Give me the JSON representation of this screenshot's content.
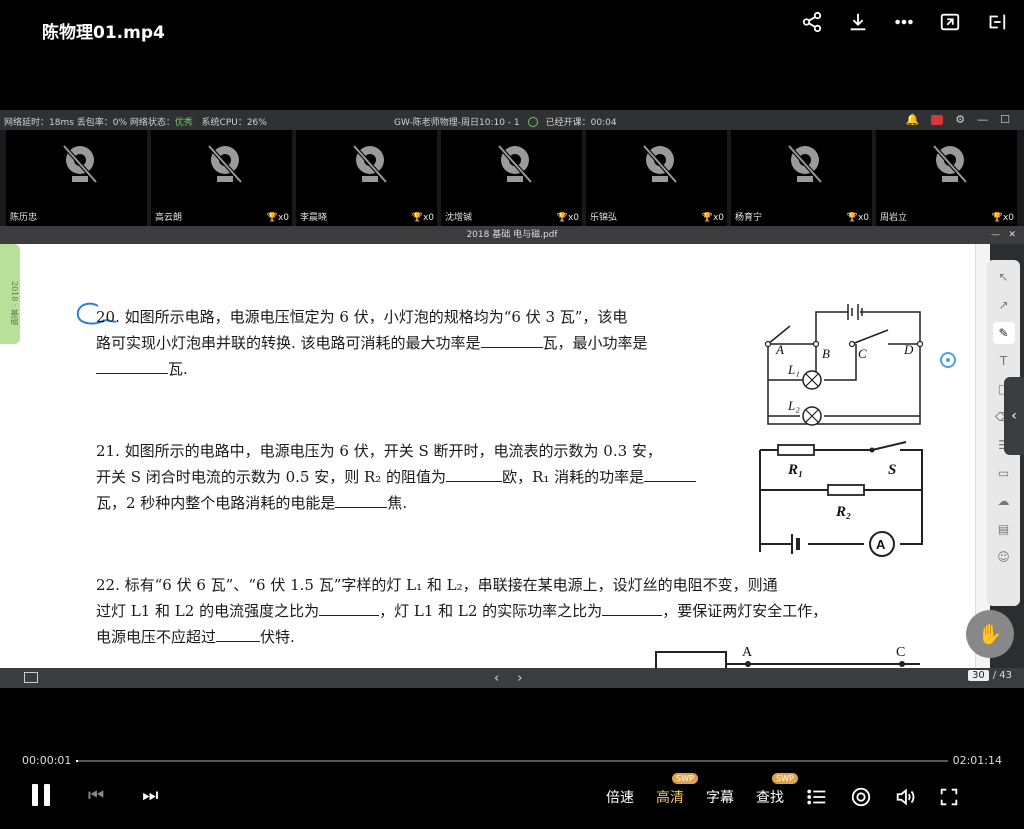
{
  "video": {
    "title": "陈物理01.mp4",
    "time_current": "00:00:01",
    "time_total": "02:01:14",
    "progress_fraction": 0.0001,
    "controls": {
      "speed": "倍速",
      "quality": "高清",
      "quality_badge": "SWP",
      "subtitle": "字幕",
      "search": "查找",
      "search_badge": "SWP"
    }
  },
  "status": {
    "left_text": "网络延时：18ms 丢包率：0% 网络状态：",
    "network_state": "优秀",
    "cpu": "系统CPU：26%",
    "class_title": "GW-陈老师物理-周日10:10 - 1",
    "elapsed": "已经开课：00:04"
  },
  "cameras": [
    {
      "name": "陈历忠",
      "score": ""
    },
    {
      "name": "高云朗",
      "score": "x0"
    },
    {
      "name": "李晨晓",
      "score": "x0"
    },
    {
      "name": "沈增铖",
      "score": "x0"
    },
    {
      "name": "乐锦弘",
      "score": "x0"
    },
    {
      "name": "杨育宁",
      "score": "x0"
    },
    {
      "name": "周岩立",
      "score": "x0"
    }
  ],
  "pdf": {
    "filename": "2018 基础 电与磁.pdf",
    "sidetab": "2018 · 基础",
    "current_page": "30",
    "total_pages": "/ 43"
  },
  "questions": {
    "q20_line1": "20. 如图所示电路，电源电压恒定为 6 伏，小灯泡的规格均为“6 伏   3 瓦”，该电",
    "q20_line2a": "路可实现小灯泡串并联的转换. 该电路可消耗的最大功率是",
    "q20_line2b": "瓦，最小功率是",
    "q20_line3": "瓦.",
    "q21_line1": "21. 如图所示的电路中，电源电压为 6 伏，开关 S 断开时，电流表的示数为 0.3 安，",
    "q21_line2a": "开关 S 闭合时电流的示数为 0.5 安，则 R₂ 的阻值为",
    "q21_line2b": "欧，R₁ 消耗的功率是",
    "q21_line3a": "瓦，2 秒种内整个电路消耗的电能是",
    "q21_line3b": "焦.",
    "q22_line1": "22. 标有“6 伏   6 瓦”、“6 伏   1.5 瓦”字样的灯 L₁ 和 L₂，串联接在某电源上，设灯丝的电阻不变，则通",
    "q22_line2a": "过灯 L1 和 L2 的电流强度之比为",
    "q22_line2b": "，灯 L1 和 L2 的实际功率之比为",
    "q22_line2c": "，要保证两灯安全工作，",
    "q22_line3a": "电源电压不应超过",
    "q22_line3b": "伏特."
  },
  "circuit1": {
    "A": "A",
    "B": "B",
    "C": "C",
    "D": "D",
    "L1": "L₁",
    "L2": "L₂"
  },
  "circuit2": {
    "R1": "R₁",
    "R2": "R₂",
    "S": "S",
    "ammeter": "A"
  },
  "circuit3": {
    "A": "A",
    "C": "C"
  }
}
